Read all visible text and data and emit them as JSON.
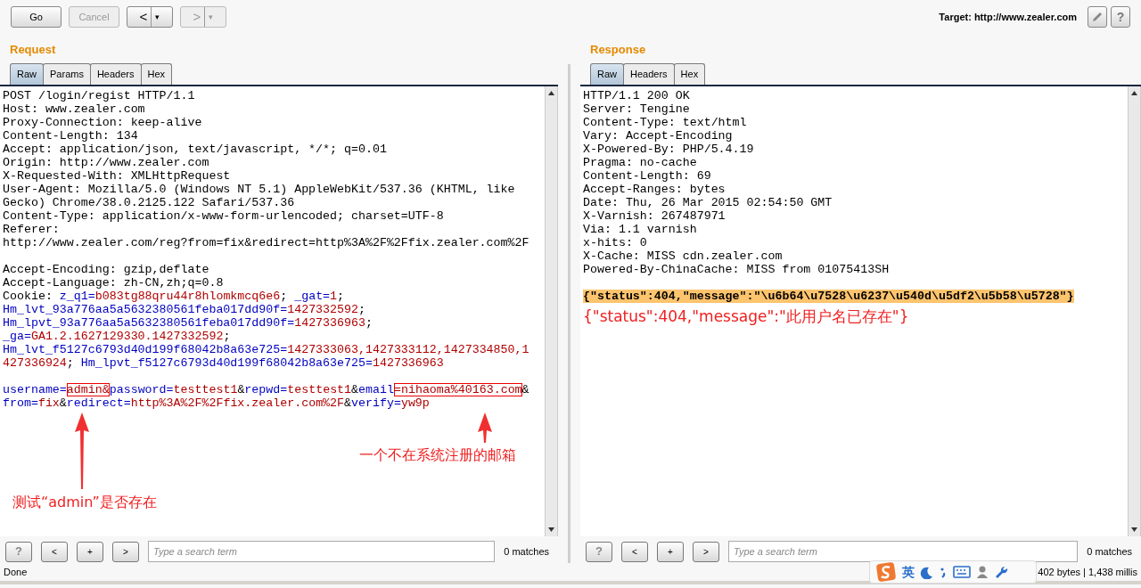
{
  "toolbar": {
    "buttons": [
      {
        "kind": "text",
        "label": "Go",
        "disabled": false
      },
      {
        "kind": "text",
        "label": "Cancel",
        "disabled": true
      },
      {
        "kind": "nav",
        "label": "<",
        "caret": "▾",
        "disabled": false
      },
      {
        "kind": "nav",
        "label": ">",
        "caret": "▾",
        "disabled": true
      }
    ],
    "target": "Target: http://www.zealer.com"
  },
  "request": {
    "title": "Request",
    "tabs": [
      {
        "label": "Raw",
        "selected": true
      },
      {
        "label": "Params",
        "selected": false
      },
      {
        "label": "Headers",
        "selected": false
      },
      {
        "label": "Hex",
        "selected": false
      }
    ],
    "lines": [
      {
        "kind": "text",
        "segments": [
          {
            "text": "POST /login/regist HTTP/1.1",
            "kind": "plain"
          }
        ]
      },
      {
        "kind": "text",
        "segments": [
          {
            "text": "Host: www.zealer.com",
            "kind": "plain"
          }
        ]
      },
      {
        "kind": "text",
        "segments": [
          {
            "text": "Proxy-Connection: keep-alive",
            "kind": "plain"
          }
        ]
      },
      {
        "kind": "text",
        "segments": [
          {
            "text": "Content-Length: 134",
            "kind": "plain"
          }
        ]
      },
      {
        "kind": "text",
        "segments": [
          {
            "text": "Accept: application/json, text/javascript, */*; q=0.01",
            "kind": "plain"
          }
        ]
      },
      {
        "kind": "text",
        "segments": [
          {
            "text": "Origin: http://www.zealer.com",
            "kind": "plain"
          }
        ]
      },
      {
        "kind": "text",
        "segments": [
          {
            "text": "X-Requested-With: XMLHttpRequest",
            "kind": "plain"
          }
        ]
      },
      {
        "kind": "text",
        "segments": [
          {
            "text": "User-Agent: Mozilla/5.0 (Windows NT 5.1) AppleWebKit/537.36 (KHTML, like",
            "kind": "plain"
          }
        ]
      },
      {
        "kind": "text",
        "segments": [
          {
            "text": "Gecko) Chrome/38.0.2125.122 Safari/537.36",
            "kind": "plain"
          }
        ]
      },
      {
        "kind": "text",
        "segments": [
          {
            "text": "Content-Type: application/x-www-form-urlencoded; charset=UTF-8",
            "kind": "plain"
          }
        ]
      },
      {
        "kind": "text",
        "segments": [
          {
            "text": "Referer:",
            "kind": "plain"
          }
        ]
      },
      {
        "kind": "text",
        "segments": [
          {
            "text": "http://www.zealer.com/reg?from=fix&redirect=http%3A%2F%2Ffix.zealer.com%2F",
            "kind": "plain"
          }
        ]
      },
      {
        "kind": "blank"
      },
      {
        "kind": "text",
        "segments": [
          {
            "text": "Accept-Encoding: gzip,deflate",
            "kind": "plain"
          }
        ]
      },
      {
        "kind": "text",
        "segments": [
          {
            "text": "Accept-Language: zh-CN,zh;q=0.8",
            "kind": "plain"
          }
        ]
      },
      {
        "kind": "text",
        "segments": [
          {
            "text": "Cookie: ",
            "kind": "plain"
          },
          {
            "text": "z_q1=",
            "kind": "name"
          },
          {
            "text": "b083tg88qru44r8hlomkmcq6e6",
            "kind": "value"
          },
          {
            "text": "; ",
            "kind": "plain"
          },
          {
            "text": "_gat=",
            "kind": "name"
          },
          {
            "text": "1",
            "kind": "value"
          },
          {
            "text": ";",
            "kind": "plain"
          }
        ]
      },
      {
        "kind": "text",
        "segments": [
          {
            "text": "Hm_lvt_93a776aa5a5632380561feba017dd90f=",
            "kind": "name"
          },
          {
            "text": "1427332592",
            "kind": "value"
          },
          {
            "text": ";",
            "kind": "plain"
          }
        ]
      },
      {
        "kind": "text",
        "segments": [
          {
            "text": "Hm_lpvt_93a776aa5a5632380561feba017dd90f=",
            "kind": "name"
          },
          {
            "text": "1427336963",
            "kind": "value"
          },
          {
            "text": ";",
            "kind": "plain"
          }
        ]
      },
      {
        "kind": "text",
        "segments": [
          {
            "text": "_ga=",
            "kind": "name"
          },
          {
            "text": "GA1.2.1627129330.1427332592",
            "kind": "value"
          },
          {
            "text": ";",
            "kind": "plain"
          }
        ]
      },
      {
        "kind": "text",
        "segments": [
          {
            "text": "Hm_lvt_f5127c6793d40d199f68042b8a63e725=",
            "kind": "name"
          },
          {
            "text": "1427333063,1427333112,1427334850,1",
            "kind": "value"
          }
        ]
      },
      {
        "kind": "text",
        "segments": [
          {
            "text": "427336924",
            "kind": "value"
          },
          {
            "text": "; ",
            "kind": "plain"
          },
          {
            "text": "Hm_lpvt_f5127c6793d40d199f68042b8a63e725=",
            "kind": "name"
          },
          {
            "text": "1427336963",
            "kind": "value"
          }
        ]
      },
      {
        "kind": "blank"
      },
      {
        "kind": "text",
        "segments": [
          {
            "text": "username=",
            "kind": "name"
          },
          {
            "text": "admin&",
            "kind": "value",
            "boxed": true
          },
          {
            "text": "password=",
            "kind": "name"
          },
          {
            "text": "testtest1",
            "kind": "value"
          },
          {
            "text": "&",
            "kind": "plain"
          },
          {
            "text": "repwd=",
            "kind": "name"
          },
          {
            "text": "testtest1",
            "kind": "value"
          },
          {
            "text": "&",
            "kind": "plain"
          },
          {
            "text": "email",
            "kind": "name"
          },
          {
            "text": "=nihaoma%40163.com",
            "kind": "value",
            "boxed": true
          },
          {
            "text": "&",
            "kind": "plain"
          }
        ]
      },
      {
        "kind": "text",
        "segments": [
          {
            "text": "from=",
            "kind": "name"
          },
          {
            "text": "fix",
            "kind": "value"
          },
          {
            "text": "&",
            "kind": "plain"
          },
          {
            "text": "redirect=",
            "kind": "name"
          },
          {
            "text": "http%3A%2F%2Ffix.zealer.com%2F",
            "kind": "value"
          },
          {
            "text": "&",
            "kind": "plain"
          },
          {
            "text": "verify=",
            "kind": "name"
          },
          {
            "text": "yw9p",
            "kind": "value"
          }
        ]
      }
    ],
    "annotations": [
      {
        "text": "一个不在系统注册的邮箱"
      },
      {
        "text": "测试“admin”是否存在"
      }
    ],
    "search": {
      "help": "?",
      "prev": "<",
      "add": "+",
      "next": ">",
      "placeholder": "Type a search term",
      "matches": "0 matches"
    }
  },
  "response": {
    "title": "Response",
    "tabs": [
      {
        "label": "Raw",
        "selected": true
      },
      {
        "label": "Headers",
        "selected": false
      },
      {
        "label": "Hex",
        "selected": false
      }
    ],
    "lines": [
      {
        "kind": "plain",
        "text": "HTTP/1.1 200 OK"
      },
      {
        "kind": "plain",
        "text": "Server: Tengine"
      },
      {
        "kind": "plain",
        "text": "Content-Type: text/html"
      },
      {
        "kind": "plain",
        "text": "Vary: Accept-Encoding"
      },
      {
        "kind": "plain",
        "text": "X-Powered-By: PHP/5.4.19"
      },
      {
        "kind": "plain",
        "text": "Pragma: no-cache"
      },
      {
        "kind": "plain",
        "text": "Content-Length: 69"
      },
      {
        "kind": "plain",
        "text": "Accept-Ranges: bytes"
      },
      {
        "kind": "plain",
        "text": "Date: Thu, 26 Mar 2015 02:54:50 GMT"
      },
      {
        "kind": "plain",
        "text": "X-Varnish: 267487971"
      },
      {
        "kind": "plain",
        "text": "Via: 1.1 varnish"
      },
      {
        "kind": "plain",
        "text": "x-hits: 0"
      },
      {
        "kind": "plain",
        "text": "X-Cache: MISS cdn.zealer.com"
      },
      {
        "kind": "plain",
        "text": "Powered-By-ChinaCache: MISS from 01075413SH"
      },
      {
        "kind": "blank"
      },
      {
        "kind": "highlight",
        "text": "{\"status\":404,\"message\":\"\\u6b64\\u7528\\u6237\\u540d\\u5df2\\u5b58\\u5728\"}"
      },
      {
        "kind": "note",
        "text": "{\"status\":404,\"message\":\"此用户名已存在\"}"
      }
    ],
    "search": {
      "help": "?",
      "prev": "<",
      "add": "+",
      "next": ">",
      "placeholder": "Type a search term",
      "matches": "0 matches"
    }
  },
  "status_bar": {
    "left": "Done",
    "ime_label": "英",
    "right": "402 bytes | 1,438 millis"
  }
}
